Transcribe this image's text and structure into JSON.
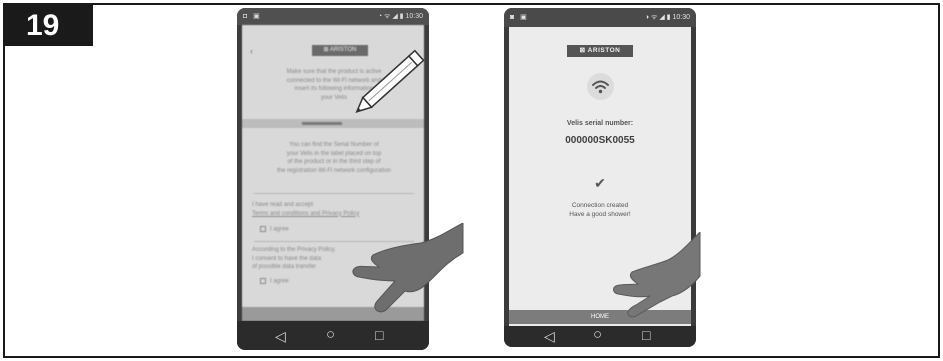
{
  "step": {
    "number": "19"
  },
  "phone_left": {
    "status_left": "◘ ▣",
    "status_right": "◔ ᯤ ◢ ▮ 10:30",
    "back": "‹",
    "brand": "⊠ ARISTON",
    "intro": [
      "Make sure that the product is active",
      "connected to the Wi-Fi network and",
      "insert its following information",
      "your Velis"
    ],
    "find_serial": [
      "You can find the Serial Number of",
      "your Velis in the label placed on top",
      "of the product or in the third step of",
      "the registration Wi-Fi network configuration"
    ],
    "terms_lead": "I have read and accept",
    "terms_link": "Terms and conditions and Privacy Policy",
    "agree_1": "I agree",
    "privacy": [
      "According to the Privacy Policy,",
      "I consent to have the data",
      "of possible data transfer"
    ],
    "agree_2": "I agree"
  },
  "phone_right": {
    "status_left": "◙ ▣",
    "status_right": "◑ ᯤ ◢ ▮ 10:30",
    "brand": "⊠ ARISTON",
    "wifi_icon": "wifi-icon",
    "serial_label": "Velis serial number:",
    "serial_value": "000000SK0055",
    "check_icon": "✔",
    "message_line1": "Connection created",
    "message_line2": "Have a good shower!",
    "home_button": "HOME"
  },
  "nav": {
    "back": "◁",
    "home": "○",
    "recents": "□"
  }
}
